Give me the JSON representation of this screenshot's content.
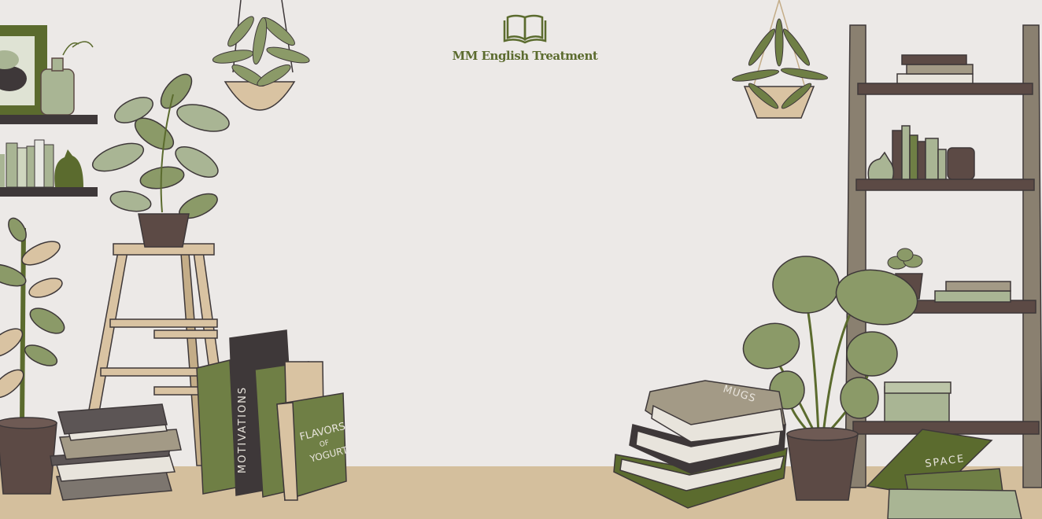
{
  "brand": {
    "title": "MM English Treatment",
    "logo_icon": "open-book-icon"
  },
  "illustration": {
    "book_spines": [
      "MOTIVATIONS",
      "FLAVORS",
      "OF",
      "YOGURT",
      "MUGS",
      "SPACE"
    ]
  },
  "colors": {
    "wall": "#ece9e7",
    "floor": "#d4bf9d",
    "accent_green": "#5b6b2e",
    "leaf_green": "#8b9a68",
    "dark_brown": "#5c4a45",
    "charcoal": "#3e3839"
  }
}
